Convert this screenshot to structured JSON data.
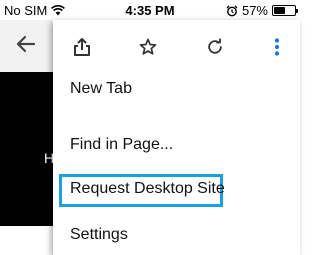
{
  "status_bar": {
    "carrier": "No SIM",
    "time": "4:35 PM",
    "battery_percent_label": "57%",
    "battery_level": 0.57
  },
  "menu": {
    "icons": [
      "share-icon",
      "bookmark-star-icon",
      "reload-icon",
      "more-vertical-icon"
    ],
    "items": [
      {
        "label": "New Tab"
      },
      {
        "label": "Find in Page..."
      },
      {
        "label": "Request Desktop Site",
        "highlighted": true
      },
      {
        "label": "Settings"
      }
    ]
  },
  "colors": {
    "highlight": "#1aa0e0",
    "more_icon": "#1a73e8",
    "toolbar": "#f2f2f2"
  }
}
